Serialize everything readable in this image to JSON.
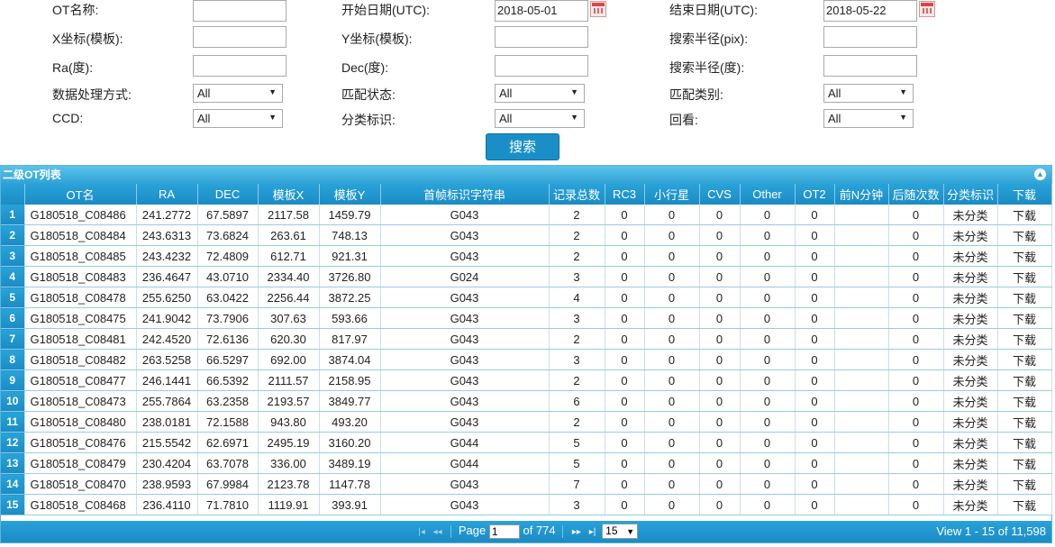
{
  "filters": {
    "ot_name": {
      "label": "OT名称:",
      "value": ""
    },
    "start_date": {
      "label": "开始日期(UTC):",
      "value": "2018-05-01"
    },
    "end_date": {
      "label": "结束日期(UTC):",
      "value": "2018-05-22"
    },
    "x_template": {
      "label": "X坐标(模板):",
      "value": ""
    },
    "y_template": {
      "label": "Y坐标(模板):",
      "value": ""
    },
    "radius_pix": {
      "label": "搜索半径(pix):",
      "value": ""
    },
    "ra": {
      "label": "Ra(度):",
      "value": ""
    },
    "dec": {
      "label": "Dec(度):",
      "value": ""
    },
    "radius_deg": {
      "label": "搜索半径(度):",
      "value": ""
    },
    "processing": {
      "label": "数据处理方式:",
      "value": "All"
    },
    "match_status": {
      "label": "匹配状态:",
      "value": "All"
    },
    "match_category": {
      "label": "匹配类别:",
      "value": "All"
    },
    "ccd": {
      "label": "CCD:",
      "value": "All"
    },
    "classification": {
      "label": "分类标识:",
      "value": "All"
    },
    "review": {
      "label": "回看:",
      "value": "All"
    },
    "search_button": "搜索"
  },
  "grid": {
    "caption": "二级OT列表",
    "columns": [
      "OT名",
      "RA",
      "DEC",
      "模板X",
      "模板Y",
      "首帧标识字符串",
      "记录总数",
      "RC3",
      "小行星",
      "CVS",
      "Other",
      "OT2",
      "前N分钟",
      "后随次数",
      "分类标识",
      "下载"
    ],
    "rows": [
      [
        "1",
        "G180518_C08486",
        "241.2772",
        "67.5897",
        "2117.58",
        "1459.79",
        "G043",
        "2",
        "0",
        "0",
        "0",
        "0",
        "0",
        "",
        "0",
        "未分类",
        "下载"
      ],
      [
        "2",
        "G180518_C08484",
        "243.6313",
        "73.6824",
        "263.61",
        "748.13",
        "G043",
        "2",
        "0",
        "0",
        "0",
        "0",
        "0",
        "",
        "0",
        "未分类",
        "下载"
      ],
      [
        "3",
        "G180518_C08485",
        "243.4232",
        "72.4809",
        "612.71",
        "921.31",
        "G043",
        "2",
        "0",
        "0",
        "0",
        "0",
        "0",
        "",
        "0",
        "未分类",
        "下载"
      ],
      [
        "4",
        "G180518_C08483",
        "236.4647",
        "43.0710",
        "2334.40",
        "3726.80",
        "G024",
        "3",
        "0",
        "0",
        "0",
        "0",
        "0",
        "",
        "0",
        "未分类",
        "下载"
      ],
      [
        "5",
        "G180518_C08478",
        "255.6250",
        "63.0422",
        "2256.44",
        "3872.25",
        "G043",
        "4",
        "0",
        "0",
        "0",
        "0",
        "0",
        "",
        "0",
        "未分类",
        "下载"
      ],
      [
        "6",
        "G180518_C08475",
        "241.9042",
        "73.7906",
        "307.63",
        "593.66",
        "G043",
        "3",
        "0",
        "0",
        "0",
        "0",
        "0",
        "",
        "0",
        "未分类",
        "下载"
      ],
      [
        "7",
        "G180518_C08481",
        "242.4520",
        "72.6136",
        "620.30",
        "817.97",
        "G043",
        "2",
        "0",
        "0",
        "0",
        "0",
        "0",
        "",
        "0",
        "未分类",
        "下载"
      ],
      [
        "8",
        "G180518_C08482",
        "263.5258",
        "66.5297",
        "692.00",
        "3874.04",
        "G043",
        "3",
        "0",
        "0",
        "0",
        "0",
        "0",
        "",
        "0",
        "未分类",
        "下载"
      ],
      [
        "9",
        "G180518_C08477",
        "246.1441",
        "66.5392",
        "2111.57",
        "2158.95",
        "G043",
        "2",
        "0",
        "0",
        "0",
        "0",
        "0",
        "",
        "0",
        "未分类",
        "下载"
      ],
      [
        "10",
        "G180518_C08473",
        "255.7864",
        "63.2358",
        "2193.57",
        "3849.77",
        "G043",
        "6",
        "0",
        "0",
        "0",
        "0",
        "0",
        "",
        "0",
        "未分类",
        "下载"
      ],
      [
        "11",
        "G180518_C08480",
        "238.0181",
        "72.1588",
        "943.80",
        "493.20",
        "G043",
        "2",
        "0",
        "0",
        "0",
        "0",
        "0",
        "",
        "0",
        "未分类",
        "下载"
      ],
      [
        "12",
        "G180518_C08476",
        "215.5542",
        "62.6971",
        "2495.19",
        "3160.20",
        "G044",
        "5",
        "0",
        "0",
        "0",
        "0",
        "0",
        "",
        "0",
        "未分类",
        "下载"
      ],
      [
        "13",
        "G180518_C08479",
        "230.4204",
        "63.7078",
        "336.00",
        "3489.19",
        "G044",
        "5",
        "0",
        "0",
        "0",
        "0",
        "0",
        "",
        "0",
        "未分类",
        "下载"
      ],
      [
        "14",
        "G180518_C08470",
        "238.9593",
        "67.9984",
        "2123.78",
        "1147.78",
        "G043",
        "7",
        "0",
        "0",
        "0",
        "0",
        "0",
        "",
        "0",
        "未分类",
        "下载"
      ],
      [
        "15",
        "G180518_C08468",
        "236.4110",
        "71.7810",
        "1119.91",
        "393.91",
        "G043",
        "3",
        "0",
        "0",
        "0",
        "0",
        "0",
        "",
        "0",
        "未分类",
        "下载"
      ]
    ]
  },
  "pager": {
    "page_label": "Page",
    "page_value": "1",
    "of_label": "of 774",
    "rows_per_page": "15",
    "summary": "View 1 - 15 of 11,598"
  }
}
